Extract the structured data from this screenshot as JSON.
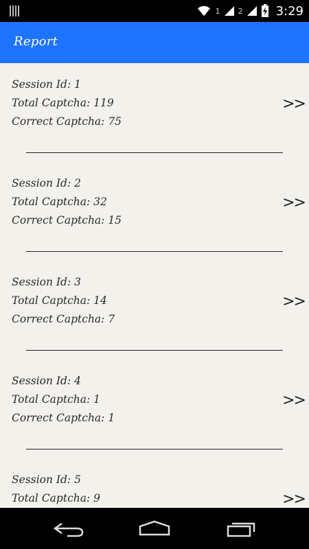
{
  "status_bar": {
    "sim1": "1",
    "sim2": "2",
    "time": "3:29",
    "icons": [
      "notification-icon",
      "wifi-icon",
      "signal-icon",
      "battery-charging-icon"
    ]
  },
  "app_bar": {
    "title": "Report",
    "color": "#1f74ff"
  },
  "sessions": [
    {
      "session": "Session Id: 1",
      "total": "Total Captcha: 119",
      "correct": "Correct Captcha: 75",
      "arrow": ">>"
    },
    {
      "session": "Session Id: 2",
      "total": "Total Captcha: 32",
      "correct": "Correct Captcha: 15",
      "arrow": ">>"
    },
    {
      "session": "Session Id: 3",
      "total": "Total Captcha: 14",
      "correct": "Correct Captcha: 7",
      "arrow": ">>"
    },
    {
      "session": "Session Id: 4",
      "total": "Total Captcha: 1",
      "correct": "Correct Captcha: 1",
      "arrow": ">>"
    },
    {
      "session": "Session Id: 5",
      "total": "Total Captcha: 9",
      "correct": "",
      "arrow": ">>"
    }
  ],
  "nav_bar": {
    "icons": [
      "back-icon",
      "home-icon",
      "recents-icon"
    ]
  }
}
